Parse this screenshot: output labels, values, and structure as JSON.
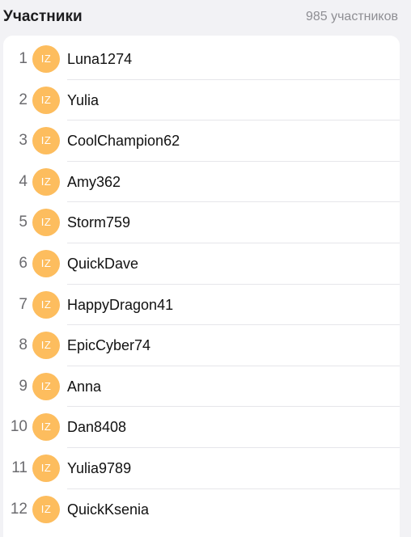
{
  "header": {
    "title": "Участники",
    "count_label": "985 участников"
  },
  "participants": [
    {
      "rank": "1",
      "avatar_initials": "IZ",
      "username": "Luna1274"
    },
    {
      "rank": "2",
      "avatar_initials": "IZ",
      "username": "Yulia"
    },
    {
      "rank": "3",
      "avatar_initials": "IZ",
      "username": "CoolChampion62"
    },
    {
      "rank": "4",
      "avatar_initials": "IZ",
      "username": "Amy362"
    },
    {
      "rank": "5",
      "avatar_initials": "IZ",
      "username": "Storm759"
    },
    {
      "rank": "6",
      "avatar_initials": "IZ",
      "username": "QuickDave"
    },
    {
      "rank": "7",
      "avatar_initials": "IZ",
      "username": "HappyDragon41"
    },
    {
      "rank": "8",
      "avatar_initials": "IZ",
      "username": "EpicCyber74"
    },
    {
      "rank": "9",
      "avatar_initials": "IZ",
      "username": "Anna"
    },
    {
      "rank": "10",
      "avatar_initials": "IZ",
      "username": "Dan8408"
    },
    {
      "rank": "11",
      "avatar_initials": "IZ",
      "username": "Yulia9789"
    },
    {
      "rank": "12",
      "avatar_initials": "IZ",
      "username": "QuickKsenia"
    }
  ],
  "colors": {
    "avatar_bg": "#fdbd5e",
    "background": "#f2f2f5",
    "card": "#ffffff"
  }
}
